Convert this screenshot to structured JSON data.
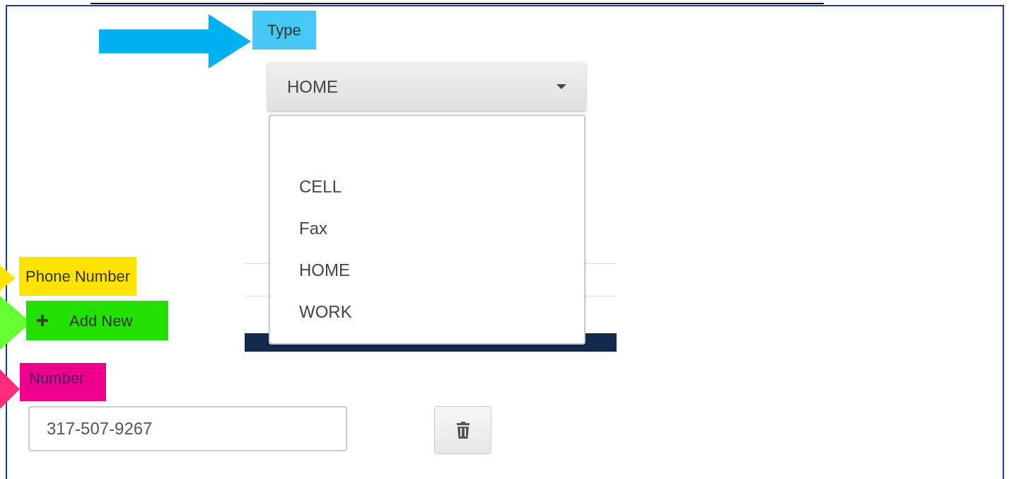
{
  "callouts": [
    {
      "text": "Type",
      "color": "#45c8f5"
    },
    {
      "text": "Phone Number",
      "color": "#ffe300"
    },
    {
      "text": "Number",
      "color": "#ec008c"
    }
  ],
  "type_dropdown": {
    "value": "HOME",
    "expanded": true,
    "options": [
      "CELL",
      "Fax",
      "HOME",
      "WORK"
    ]
  },
  "add_button": {
    "label": "Add New",
    "color": "#22e000"
  },
  "number_field": {
    "value": "317-507-9267"
  }
}
